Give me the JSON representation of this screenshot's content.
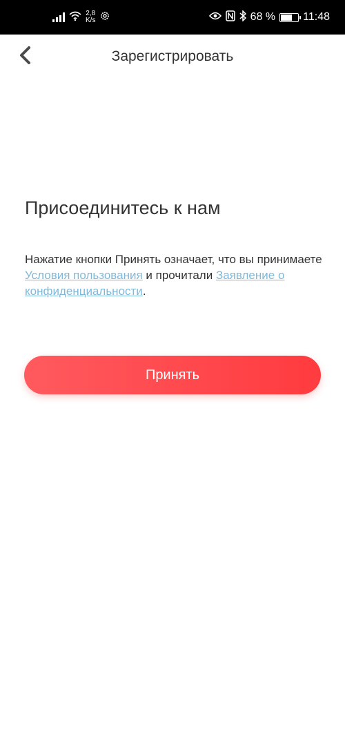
{
  "status_bar": {
    "speed_value": "2,8",
    "speed_unit": "K/s",
    "battery_percent": "68 %",
    "time": "11:48",
    "battery_level": 0.68,
    "icons": [
      "signal-icon",
      "wifi-icon",
      "settings-icon",
      "eye-icon",
      "nfc-icon",
      "bluetooth-icon",
      "battery-icon"
    ]
  },
  "header": {
    "title": "Зарегистрировать",
    "back_icon": "chevron-left-icon"
  },
  "main": {
    "heading": "Присоединитесь к нам",
    "terms_prefix": "Нажатие кнопки Принять означает, что вы принимаете ",
    "terms_link": "Условия пользования",
    "terms_middle": " и прочитали ",
    "privacy_link": "Заявление о конфиденциальности",
    "terms_suffix": ".",
    "link_color": "#7fb8d9"
  },
  "actions": {
    "accept_label": "Принять",
    "accent_color": "#ff4046"
  }
}
